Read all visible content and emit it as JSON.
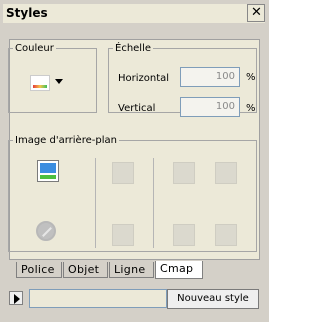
{
  "window": {
    "title": "Styles",
    "close_symbol": "X"
  },
  "couleur": {
    "legend": "Couleur"
  },
  "echelle": {
    "legend": "Échelle",
    "horizontal_label": "Horizontal",
    "horizontal_value": "100",
    "vertical_label": "Vertical",
    "vertical_value": "100",
    "unit": "%"
  },
  "image_bg": {
    "legend": "Image d'arrière-plan",
    "icons": [
      "insert-image-icon",
      "no-image-icon",
      "layout-icon-1",
      "layout-icon-2",
      "tile-icon",
      "align-icon",
      "position-icon-1",
      "position-icon-2"
    ]
  },
  "tabs": [
    {
      "label": "Police"
    },
    {
      "label": "Objet"
    },
    {
      "label": "Ligne"
    },
    {
      "label": "Cmap"
    }
  ],
  "bottom": {
    "new_style_label": "Nouveau style"
  }
}
